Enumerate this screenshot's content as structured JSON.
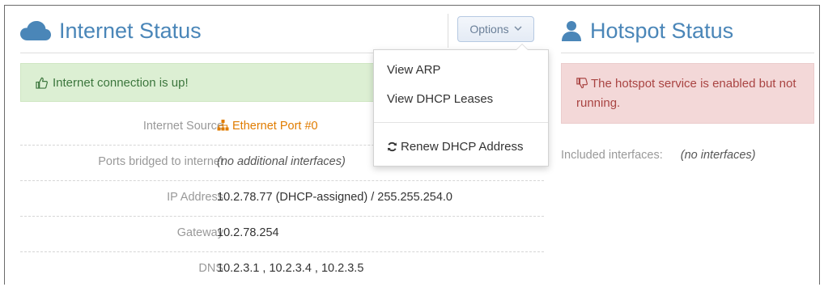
{
  "internet": {
    "title": "Internet Status",
    "options_label": "Options",
    "status_alert": "Internet connection is up!",
    "rows": [
      {
        "label": "Internet Source",
        "value": "Ethernet Port #0"
      },
      {
        "label": "Ports bridged to internet",
        "value": "(no additional interfaces)"
      },
      {
        "label": "IP Address",
        "value": "10.2.78.77 (DHCP-assigned) / 255.255.254.0"
      },
      {
        "label": "Gateway",
        "value": "10.2.78.254"
      },
      {
        "label": "DNS",
        "value": "10.2.3.1 , 10.2.3.4 , 10.2.3.5"
      }
    ]
  },
  "options_menu": {
    "items": [
      "View ARP",
      "View DHCP Leases"
    ],
    "renew_label": "Renew DHCP Address"
  },
  "hotspot": {
    "title": "Hotspot Status",
    "status_alert": "The hotspot service is enabled but not running.",
    "included_label": "Included interfaces:",
    "included_value": "(no interfaces)"
  },
  "colors": {
    "title_blue": "#4a86b8",
    "success_bg": "#dcefd3",
    "success_text": "#3c763d",
    "danger_bg": "#f3d8d8",
    "danger_text": "#a94442",
    "source_orange": "#e07c00"
  },
  "icons": {
    "internet_title": "cloud-icon",
    "hotspot_title": "user-icon",
    "success_alert": "thumbs-up-icon",
    "danger_alert": "thumbs-down-icon",
    "internet_source": "sitemap-icon",
    "renew": "refresh-icon",
    "options": "chevron-down-icon"
  }
}
